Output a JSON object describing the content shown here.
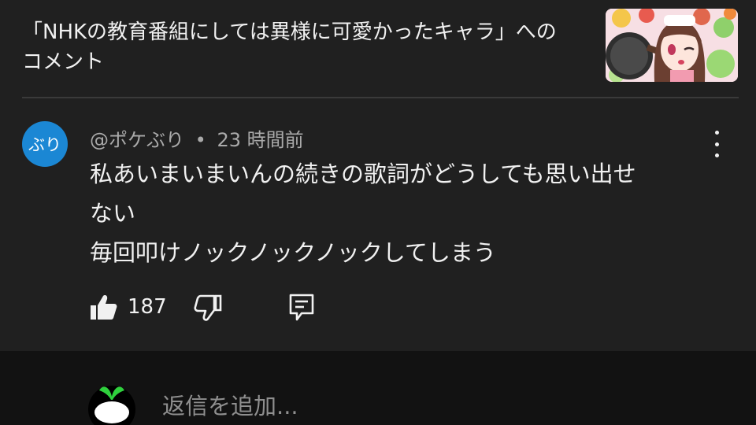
{
  "header": {
    "title_line1": "「NHKの教育番組にしては異様に可愛かったキャラ」への",
    "title_line2": "コメント",
    "thumbnail_icon": "anime-girl-cooking-thumbnail"
  },
  "comment": {
    "avatar_text": "ぶり",
    "avatar_color": "#1b87d4",
    "author": "@ポケぶり",
    "separator": "•",
    "time": "23 時間前",
    "lines": [
      "私あいまいまいんの続きの歌詞がどうしても思い出せ",
      "ない",
      "毎回叩けノックノックノックしてしまう"
    ],
    "likes": "187"
  },
  "actions": {
    "like_icon": "thumbs-up-icon",
    "dislike_icon": "thumbs-down-icon",
    "reply_icon": "reply-icon",
    "more_icon": "more-vertical-icon"
  },
  "reply": {
    "placeholder": "返信を追加...",
    "avatar_icon": "radish-avatar-icon"
  }
}
